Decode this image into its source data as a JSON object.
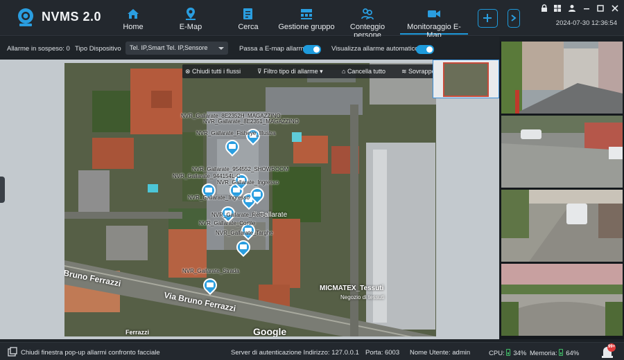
{
  "app": {
    "brand": "NVMS 2.0"
  },
  "nav": {
    "items": [
      {
        "label": "Home",
        "icon": "home-icon"
      },
      {
        "label": "E-Map",
        "icon": "map-pin-icon"
      },
      {
        "label": "Cerca",
        "icon": "search-doc-icon"
      },
      {
        "label": "Gestione gruppo",
        "icon": "group-icon"
      },
      {
        "label": "Conteggio persone",
        "icon": "people-count-icon"
      },
      {
        "label": "Monitoraggio E-Map",
        "icon": "video-camera-icon"
      }
    ],
    "active": "Monitoraggio E-Map",
    "add_icon": "plus-icon",
    "more_icon": "chevron-right-icon"
  },
  "window": {
    "datetime": "2024-07-30 12:36:54",
    "controls": [
      "lock-icon",
      "grid-icon",
      "user-icon",
      "minimize-icon",
      "maximize-icon",
      "close-icon"
    ]
  },
  "filterbar": {
    "pending": "Allarme in sospeso: 0",
    "device_type_label": "Tipo Dispositivo",
    "device_type_value": "Tel. IP,Smart Tel. IP,Sensore",
    "emap_switch_label": "Passa a E-map allarmi",
    "auto_show_label": "Visualizza allarme automatico"
  },
  "map_toolbar": {
    "close_all": "Chiudi tutti i flussi",
    "filter": "Filtro tipo di allarme",
    "clear_all": "Cancella tutto",
    "overlay": "Sovrapposto"
  },
  "cameras": [
    "NVR_Gallarate_8E2352H_MAGAZZINO",
    "NVR_Gallarate_8E2351_MAGAZZINO",
    "NVR_Gallarate_Fisheye_Illustra",
    "NVR_Gallarate_954552_SHOWROOM",
    "NVR_Gallarate_944154L-C",
    "NVR_Gallarate_Ingresso",
    "NVR_Gallarate_Ingresso",
    "NVR_Gallarate_Retro",
    "NVR_Gallarate_Cortile",
    "NVR_Gallarate_Targhe",
    "NVR_Gallarate_Strada"
  ],
  "map_labels": {
    "street_1": "Bruno Ferrazzi",
    "street_2": "Via Bruno Ferrazzi",
    "street_3": "Ferrazzi",
    "business": "MICMATEX_Tessuti",
    "business_sub": "Negozio di tessuti",
    "place": "di Gallarate",
    "attribution": "Google"
  },
  "statusbar": {
    "close_popup": "Chiudi finestra pop-up allarmi confronto facciale",
    "auth_server": "Server di autenticazione Indirizzo: 127.0.0.1",
    "port": "Porta: 6003",
    "username": "Nome Utente: admin",
    "cpu": "CPU:",
    "cpu_value": "34%",
    "memory": "Memoria:",
    "memory_value": "64%",
    "alarm_badge": "99+"
  },
  "colors": {
    "accent": "#1e9bdc",
    "topbar": "#23282e",
    "toggle_on": "#1e9bdc",
    "alarm_red": "#e23b3b",
    "ok_green": "#42c06a"
  }
}
